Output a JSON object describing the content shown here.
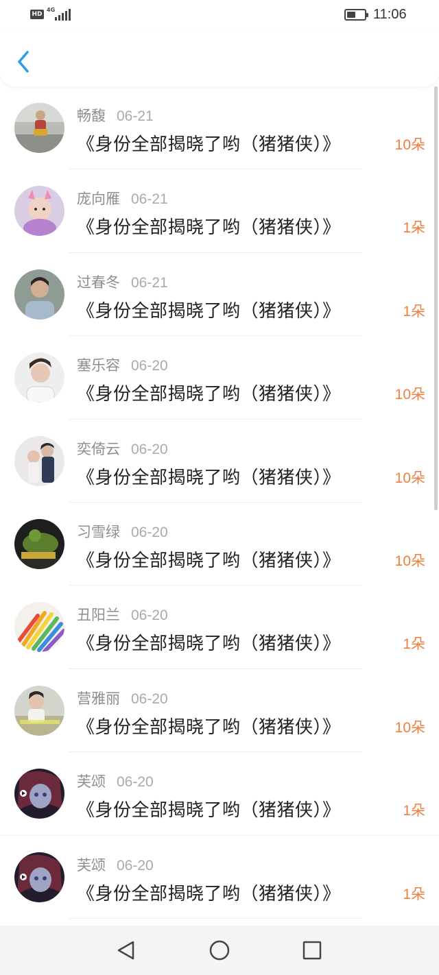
{
  "status_bar": {
    "hd": "HD",
    "network": "4G",
    "time": "11:06"
  },
  "header": {
    "back_icon": "chevron-left-icon",
    "accent_color": "#2b9bea"
  },
  "list": {
    "items": [
      {
        "name": "畅馥",
        "date": "06-21",
        "title": "《身份全部揭晓了哟（猪猪侠）》",
        "flowers": "10朵"
      },
      {
        "name": "庞向雁",
        "date": "06-21",
        "title": "《身份全部揭晓了哟（猪猪侠）》",
        "flowers": "1朵"
      },
      {
        "name": "过春冬",
        "date": "06-21",
        "title": "《身份全部揭晓了哟（猪猪侠）》",
        "flowers": "1朵"
      },
      {
        "name": "塞乐容",
        "date": "06-20",
        "title": "《身份全部揭晓了哟（猪猪侠）》",
        "flowers": "10朵"
      },
      {
        "name": "奕倚云",
        "date": "06-20",
        "title": "《身份全部揭晓了哟（猪猪侠）》",
        "flowers": "10朵"
      },
      {
        "name": "习雪绿",
        "date": "06-20",
        "title": "《身份全部揭晓了哟（猪猪侠）》",
        "flowers": "10朵"
      },
      {
        "name": "丑阳兰",
        "date": "06-20",
        "title": "《身份全部揭晓了哟（猪猪侠）》",
        "flowers": "1朵"
      },
      {
        "name": "营雅丽",
        "date": "06-20",
        "title": "《身份全部揭晓了哟（猪猪侠）》",
        "flowers": "10朵"
      },
      {
        "name": "芙颂",
        "date": "06-20",
        "title": "《身份全部揭晓了哟（猪猪侠）》",
        "flowers": "1朵"
      },
      {
        "name": "芙颂",
        "date": "06-20",
        "title": "《身份全部揭晓了哟（猪猪侠）》",
        "flowers": "1朵"
      }
    ]
  },
  "nav_bar": {
    "icons": [
      "back-triangle-icon",
      "home-circle-icon",
      "recents-square-icon"
    ]
  },
  "colors": {
    "flowers": "#ee7f3e",
    "name": "#8e8e8e",
    "title": "#222222"
  }
}
